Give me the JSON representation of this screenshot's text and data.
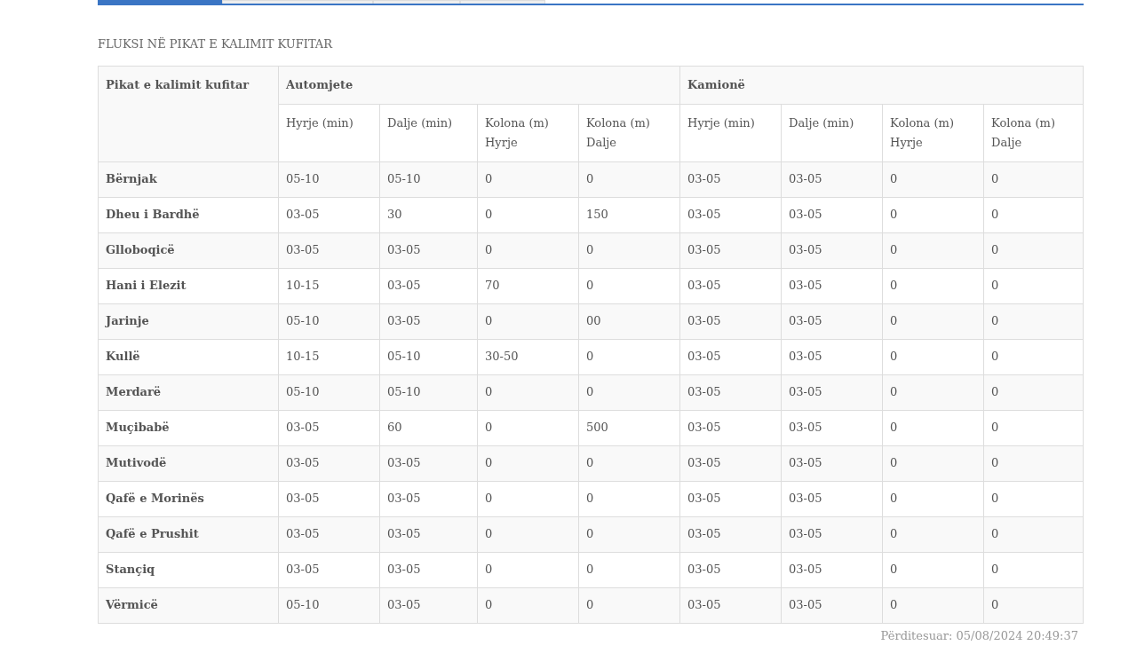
{
  "tabs": [
    {
      "selected": true
    },
    {
      "selected": false
    },
    {
      "selected": false
    },
    {
      "selected": false
    }
  ],
  "title": "FLUKSI NË PIKAT E KALIMIT KUFITAR",
  "table": {
    "corner_header": "Pikat e kalimit kufitar",
    "groups": [
      {
        "label": "Automjete",
        "columns": [
          "Hyrje (min)",
          "Dalje (min)",
          "Kolona (m) Hyrje",
          "Kolona (m) Dalje"
        ]
      },
      {
        "label": "Kamionë",
        "columns": [
          "Hyrje (min)",
          "Dalje (min)",
          "Kolona (m) Hyrje",
          "Kolona (m) Dalje"
        ]
      }
    ],
    "rows": [
      {
        "name": "Bërnjak",
        "cells": [
          "05-10",
          "05-10",
          "0",
          "0",
          "03-05",
          "03-05",
          "0",
          "0"
        ]
      },
      {
        "name": "Dheu i Bardhë",
        "cells": [
          "03-05",
          "30",
          "0",
          "150",
          "03-05",
          "03-05",
          "0",
          "0"
        ]
      },
      {
        "name": "Glloboqicë",
        "cells": [
          "03-05",
          "03-05",
          "0",
          "0",
          "03-05",
          "03-05",
          "0",
          "0"
        ]
      },
      {
        "name": "Hani i Elezit",
        "cells": [
          "10-15",
          "03-05",
          "70",
          "0",
          "03-05",
          "03-05",
          "0",
          "0"
        ]
      },
      {
        "name": "Jarinje",
        "cells": [
          "05-10",
          "03-05",
          "0",
          "00",
          "03-05",
          "03-05",
          "0",
          "0"
        ]
      },
      {
        "name": "Kullë",
        "cells": [
          "10-15",
          "05-10",
          "30-50",
          "0",
          "03-05",
          "03-05",
          "0",
          "0"
        ]
      },
      {
        "name": "Merdarë",
        "cells": [
          "05-10",
          "05-10",
          "0",
          "0",
          "03-05",
          "03-05",
          "0",
          "0"
        ]
      },
      {
        "name": "Muçibabë",
        "cells": [
          "03-05",
          "60",
          "0",
          "500",
          "03-05",
          "03-05",
          "0",
          "0"
        ]
      },
      {
        "name": "Mutivodë",
        "cells": [
          "03-05",
          "03-05",
          "0",
          "0",
          "03-05",
          "03-05",
          "0",
          "0"
        ]
      },
      {
        "name": "Qafë e Morinës",
        "cells": [
          "03-05",
          "03-05",
          "0",
          "0",
          "03-05",
          "03-05",
          "0",
          "0"
        ]
      },
      {
        "name": "Qafë e Prushit",
        "cells": [
          "03-05",
          "03-05",
          "0",
          "0",
          "03-05",
          "03-05",
          "0",
          "0"
        ]
      },
      {
        "name": "Stançiq",
        "cells": [
          "03-05",
          "03-05",
          "0",
          "0",
          "03-05",
          "03-05",
          "0",
          "0"
        ]
      },
      {
        "name": "Vërmicë",
        "cells": [
          "05-10",
          "03-05",
          "0",
          "0",
          "03-05",
          "03-05",
          "0",
          "0"
        ]
      }
    ]
  },
  "updated": "Përditesuar: 05/08/2024 20:49:37"
}
